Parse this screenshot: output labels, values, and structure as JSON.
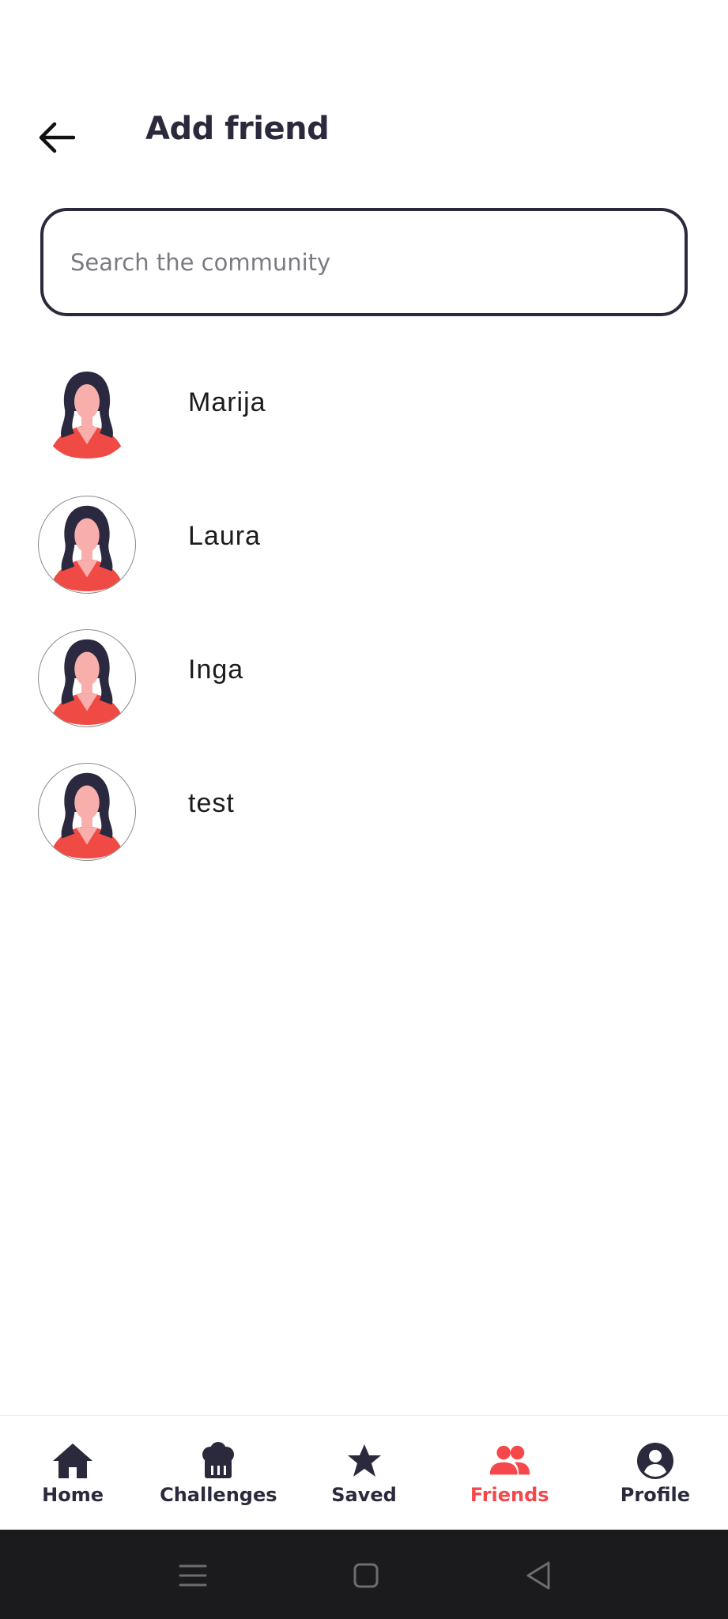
{
  "header": {
    "title": "Add friend",
    "back_icon": "arrow-left-icon"
  },
  "search": {
    "placeholder": "Search the community",
    "value": ""
  },
  "friends": [
    {
      "name": "Marija",
      "avatar": "woman-avatar-icon",
      "ring": false
    },
    {
      "name": "Laura",
      "avatar": "woman-avatar-icon",
      "ring": true
    },
    {
      "name": "Inga",
      "avatar": "woman-avatar-icon",
      "ring": true
    },
    {
      "name": "test",
      "avatar": "woman-avatar-icon",
      "ring": true
    }
  ],
  "bottom_nav": {
    "items": [
      {
        "label": "Home",
        "icon": "home-icon",
        "active": false
      },
      {
        "label": "Challenges",
        "icon": "chef-hat-icon",
        "active": false
      },
      {
        "label": "Saved",
        "icon": "star-icon",
        "active": false
      },
      {
        "label": "Friends",
        "icon": "friends-icon",
        "active": true
      },
      {
        "label": "Profile",
        "icon": "profile-icon",
        "active": false
      }
    ]
  },
  "system_nav": {
    "buttons": [
      "menu-icon",
      "home-square-icon",
      "back-triangle-icon"
    ]
  },
  "colors": {
    "text_dark": "#2a2a3c",
    "accent": "#f6474a",
    "avatar_shirt": "#f04a45",
    "avatar_skin": "#f8aeaa",
    "avatar_hair": "#2b2940",
    "system_bar": "#1b1a1d"
  }
}
